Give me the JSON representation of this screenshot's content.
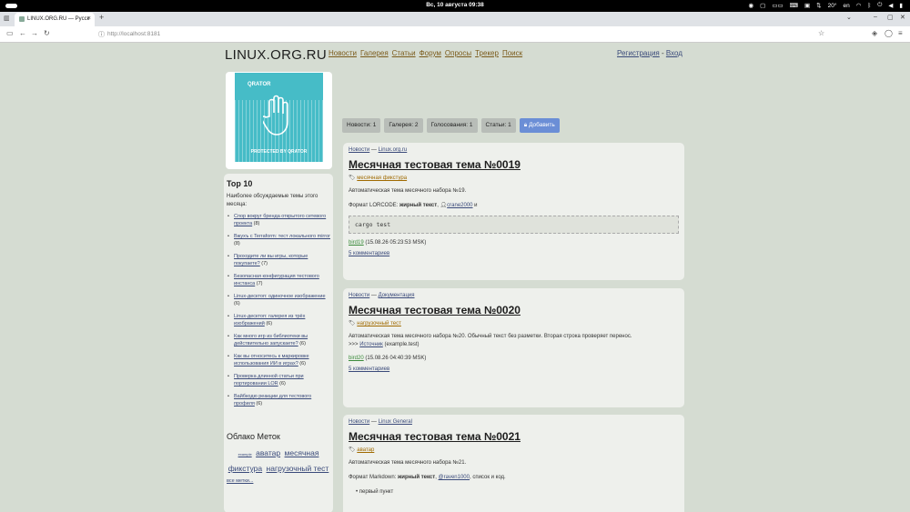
{
  "os": {
    "clock": "Вс, 10 августа  09:38",
    "temperature": "20°",
    "language": "en"
  },
  "browser": {
    "tab_title": "LINUX.ORG.RU — Русск",
    "url": "http://localhost:8181"
  },
  "site": {
    "logo": "LINUX.ORG.RU",
    "nav": [
      "Новости",
      "Галерея",
      "Статьи",
      "Форум",
      "Опросы",
      "Трекер",
      "Поиск"
    ],
    "register": "Регистрация",
    "auth_sep": " - ",
    "login": "Вход"
  },
  "banner": {
    "brand": "QRATOR",
    "caption": "PROTECTED BY QRATOR"
  },
  "top10": {
    "title": "Top 10",
    "subtitle": "Наиболее обсуждаемые темы этого месяца:",
    "items": [
      {
        "title": "Спор вокруг бренда открытого сетевого проекта",
        "count": "(8)"
      },
      {
        "title": "Вжухъ с Terraform: тест локального mirror",
        "count": "(8)"
      },
      {
        "title": "Проходите ли вы игры, которые покупаете?",
        "count": "(7)"
      },
      {
        "title": "Безопасная конфигурация тестового инстанса",
        "count": "(7)"
      },
      {
        "title": "Linux-десктоп: одиночное изображение",
        "count": "(6)"
      },
      {
        "title": "Linux-десктоп: галерея из трёх изображений",
        "count": "(6)"
      },
      {
        "title": "Как много игр из библиотеки вы действительно запускаете?",
        "count": "(6)"
      },
      {
        "title": "Как вы относитесь к маркировке использования ИИ в играх?",
        "count": "(6)"
      },
      {
        "title": "Проверка длинной статьи при портировании LOR",
        "count": "(6)"
      },
      {
        "title": "Вайбкодю реакции для тестового профиля",
        "count": "(6)"
      }
    ]
  },
  "tag_cloud": {
    "title": "Облако Меток",
    "tags": [
      "example",
      "аватар",
      "месячная фикстура",
      "нагрузочный тест"
    ],
    "all_tags": "все метки..."
  },
  "section_tabs": {
    "news": "Новости: 1",
    "gallery": "Галерея: 2",
    "polls": "Голосования: 1",
    "articles": "Статьи: 1",
    "add": "Добавить"
  },
  "posts": [
    {
      "section": "Новости",
      "sep": " — ",
      "group": "Linux.org.ru",
      "title": "Месячная тестовая тема №0019",
      "tag": "месячная фикстура",
      "body1": "Автоматическая тема месячного набора №19.",
      "body2_prefix": "Формат LORCODE: ",
      "body2_bold": "жирный текст",
      "body2_mid": ", ",
      "body2_user": "crane2000",
      "body2_suffix": " и",
      "code": "cargo test",
      "author": "bird19",
      "date": "(15.08.26 05:23:53 MSK)",
      "comments": "5 комментариев"
    },
    {
      "section": "Новости",
      "sep": " — ",
      "group": "Документация",
      "title": "Месячная тестовая тема №0020",
      "tag": "нагрузочный тест",
      "body1": "Автоматическая тема месячного набора №20. Обычный текст без разметки. Вторая строка проверяет перенос.",
      "quote_prefix": ">>> ",
      "quote_link": "Источник",
      "quote_suffix": " (example.test)",
      "author": "bird20",
      "date": "(15.08.26 04:40:39 MSK)",
      "comments": "5 комментариев"
    },
    {
      "section": "Новости",
      "sep": " — ",
      "group": "Linux General",
      "title": "Месячная тестовая тема №0021",
      "tag": "аватар",
      "body1": "Автоматическая тема месячного набора №21.",
      "body2_prefix": "Формат Markdown: ",
      "body2_bold": "жирный текст",
      "body2_mid": ", ",
      "body2_user": "@raven1000",
      "body2_suffix": ", список и код.",
      "list_item": "первый пункт"
    }
  ]
}
